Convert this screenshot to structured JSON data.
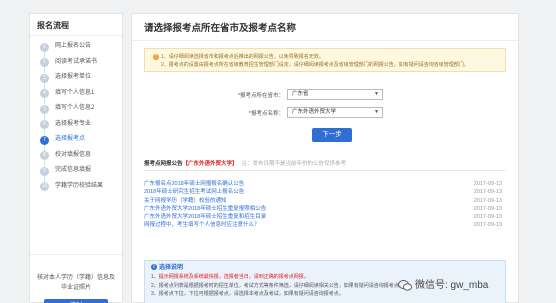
{
  "sidebar": {
    "title": "报名流程",
    "steps": [
      {
        "num": "1",
        "label": "网上报名公告"
      },
      {
        "num": "2",
        "label": "阅读考试承诺书"
      },
      {
        "num": "3",
        "label": "选择报考单位"
      },
      {
        "num": "4",
        "label": "填写个人信息1"
      },
      {
        "num": "5",
        "label": "填写个人信息2"
      },
      {
        "num": "6",
        "label": "选择报考专业"
      },
      {
        "num": "7",
        "label": "选择报考点"
      },
      {
        "num": "8",
        "label": "校对填报信息"
      },
      {
        "num": "9",
        "label": "完成信息填报"
      },
      {
        "num": "10",
        "label": "学籍学历校验结果"
      }
    ],
    "xueli_q1": "核对本人学历（学籍）信息及",
    "xueli_q2": "毕业证照片",
    "verify_button": "核对"
  },
  "main": {
    "title": "请选择报考点所在省市及报考点名称",
    "notice": [
      "1、请仔细阅读选择省市和报考点后推出的网报公告，以免导致报名无效。",
      "2、报考点的设置由报考点所在省级教育招生管理部门设定，请仔细阅读报考点及省级管理部门的网报公告，如有疑问请咨询省级管理部门。"
    ],
    "province_label": "*报考点所在省市：",
    "province_value": "广东省",
    "site_label": "*报考点名称：",
    "site_value": "广东外语外贸大学",
    "next_button": "下一步",
    "bulletin_title": "报考点网报公告",
    "bulletin_site": "【广东外语外贸大学】",
    "bulletin_tip": "注：发布日期不是当前年份的公告仅供参考",
    "bulletins": [
      {
        "title": "广东报名点2018年硕士网报报名确认公告",
        "date": "2017-09-13"
      },
      {
        "title": "2018年硕士研究生招生考试网上报名公告",
        "date": "2017-09-13"
      },
      {
        "title": "关于网报学历（学籍）校验的通知",
        "date": "2017-09-13"
      },
      {
        "title": "广东外语外贸大学2018年硕士招生重复报照相公告",
        "date": "2017-09-13"
      },
      {
        "title": "广东外语外贸大学2018年硕士招生重复和招生目录",
        "date": "2017-09-13"
      },
      {
        "title": "网报过程中，考生填写个人信息时应注意什么？",
        "date": "2017-09-13"
      }
    ],
    "explain_title": "选择说明",
    "explain": [
      {
        "pre": "1、",
        "red": "提示网报系统及系统最快报，选报者当日，请到正确的报考点网报。",
        "post": ""
      },
      {
        "pre": "2、报考点列表是根据报考时的招生单位，考试方式等条件筛选，请仔细阅读相关公告，如果有疑问请咨询报考点。",
        "red": "",
        "post": ""
      },
      {
        "pre": "3、报考点下拉，下拉可根据报考点，请选择本考点及考试，如果有疑问请咨询报考点。",
        "red": "",
        "post": ""
      }
    ]
  },
  "watermark": "微信号: gw_mba"
}
